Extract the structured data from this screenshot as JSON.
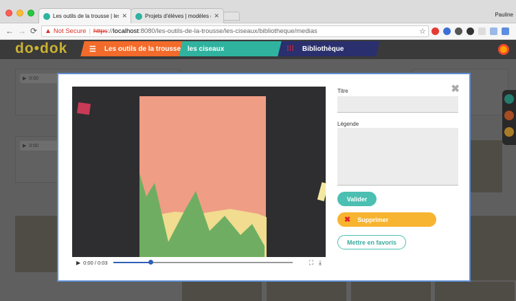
{
  "browser": {
    "tabs": [
      {
        "title": "Les outils de la trousse | les ci",
        "active": true
      },
      {
        "title": "Projets d'élèves | modèles de",
        "active": false
      }
    ],
    "profile_name": "Pauline",
    "security_label": "Not Secure",
    "url_scheme": "https",
    "url_sep": "://",
    "url_host": "localhost",
    "url_path": ":8080/les-outils-de-la-trousse/les-ciseaux/bibliotheque/medias"
  },
  "site": {
    "logo": "do•dok",
    "nav": [
      "Les outils de la trousse",
      "les ciseaux",
      "Bibliothèque"
    ]
  },
  "background": {
    "audio_time": "0:00"
  },
  "modal": {
    "video": {
      "time_display": "0:00 / 0:03",
      "progress": 0.21
    },
    "form": {
      "title_label": "Titre",
      "title_value": "",
      "caption_label": "Légende",
      "caption_value": "",
      "validate_label": "Valider",
      "delete_label": "Supprimer",
      "favorite_label": "Mettre en favoris"
    }
  },
  "colors": {
    "accent_teal": "#4bbfb1",
    "accent_orange": "#f7b430",
    "delete_red": "#e2202b",
    "nav_orange": "#f36b2a",
    "nav_teal": "#2fb39f",
    "nav_navy": "#2a2f6e"
  }
}
